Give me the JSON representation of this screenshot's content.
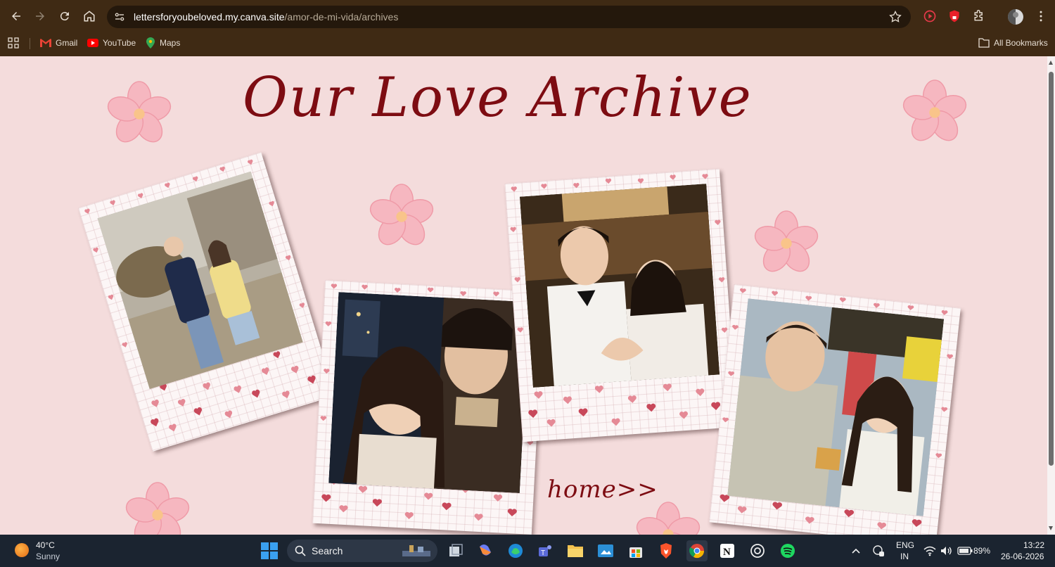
{
  "browser": {
    "url_host": "lettersforyoubeloved.my.canva.site",
    "url_path": "/amor-de-mi-vida/archives",
    "bookmarks": [
      {
        "label": "Gmail",
        "icon": "gmail-icon"
      },
      {
        "label": "YouTube",
        "icon": "youtube-icon"
      },
      {
        "label": "Maps",
        "icon": "maps-icon"
      }
    ],
    "all_bookmarks_label": "All Bookmarks"
  },
  "page": {
    "title": "Our Love Archive",
    "home_link": "home>>",
    "photo_count": 4
  },
  "colors": {
    "chrome_bg": "#3f2a14",
    "page_bg": "#f4dcdc",
    "title_color": "#7d0c12",
    "flower_pink": "#f6b7c0",
    "heart_pink": "#e58a96",
    "heart_red": "#c8485a"
  },
  "taskbar": {
    "weather_temp": "40°C",
    "weather_desc": "Sunny",
    "search_label": "Search",
    "lang_top": "ENG",
    "lang_bottom": "IN",
    "battery": "89%",
    "time": "13:22",
    "date": "26-06-2026"
  }
}
